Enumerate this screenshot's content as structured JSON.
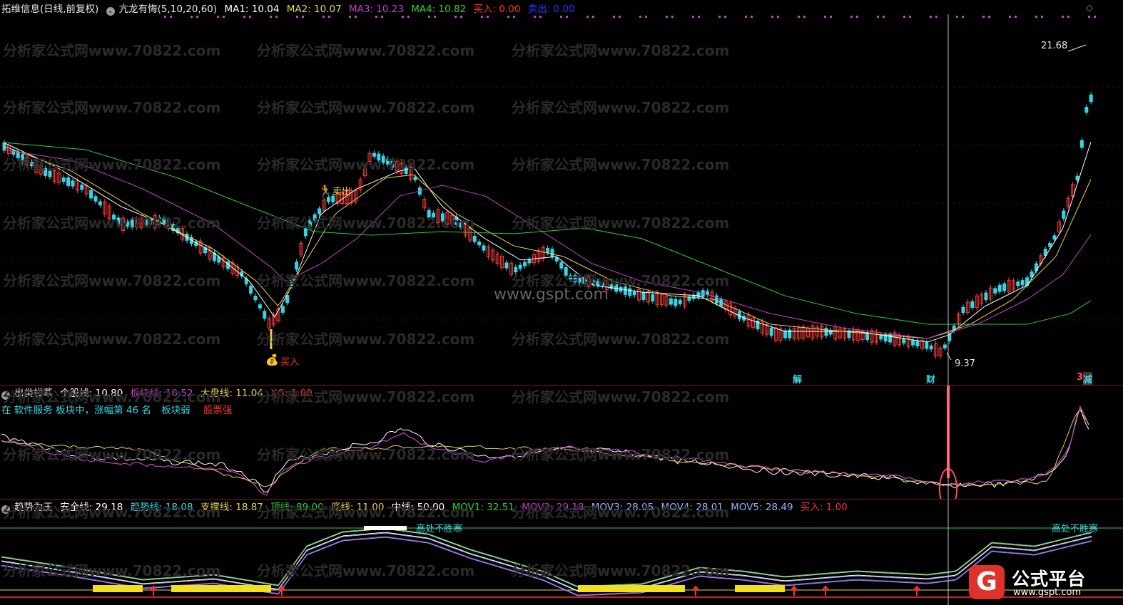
{
  "colors": {
    "ma1": "#ffffff",
    "ma2": "#e8d44d",
    "ma3": "#c63fc6",
    "ma4": "#2fd22f",
    "buy": "#ff3030",
    "sell": "#3030ff",
    "up": "#ff3b3b",
    "down": "#35d5e5",
    "cyan": "#35d5e5"
  },
  "main": {
    "title": "拓维信息(日线,前复权)",
    "indicator": "亢龙有悔(5,10,20,60)",
    "ma1": "MA1: 10.04",
    "ma2": "MA2: 10.07",
    "ma3": "MA3: 10.23",
    "ma4": "MA4: 10.82",
    "buy": "买入: 0.00",
    "sell": "卖出: 0.00",
    "max_price": "21.68",
    "min_price": "9.37",
    "buy_marker": "买入",
    "sell_marker": "卖出",
    "site_watermark": "www.gspt.com",
    "tag_jie": "解",
    "tag_cai": "财",
    "tag_jian": "减",
    "tag_num": "3"
  },
  "watermark": "分析家公式网www.70822.com",
  "panel2": {
    "name": "出类拔萃",
    "gegu": "个股线: 10.80",
    "bankuai": "板块线: 10.52",
    "dapan": "大盘线: 11.04",
    "xg": "XG: 1.00",
    "line2a": "在 软件服务 板块中，涨幅第 46 名",
    "line2b": "板块弱",
    "line2c": "股票强"
  },
  "panel3": {
    "name": "趋势为王",
    "anquan": "安全线: 29.18",
    "qushi": "趋势线: 18.08",
    "zhicheng": "支撑线: 18.87",
    "ding": "顶线: 89.00",
    "di": "底线: 11.00",
    "zhong": "中线: 50.00",
    "mov1": "MOV1: 32.51",
    "mov2": "MOV2: 29.18",
    "mov3": "MOV3: 28.05",
    "mov4": "MOV4: 28.01",
    "mov5": "MOV5: 28.49",
    "buy": "买入: 1.00",
    "gaochu": "高处不胜寒",
    "gaochu2": "高处不胜寒"
  },
  "logo": {
    "mark": "G",
    "name": "公式平台",
    "url": "www.gspt.com"
  }
}
